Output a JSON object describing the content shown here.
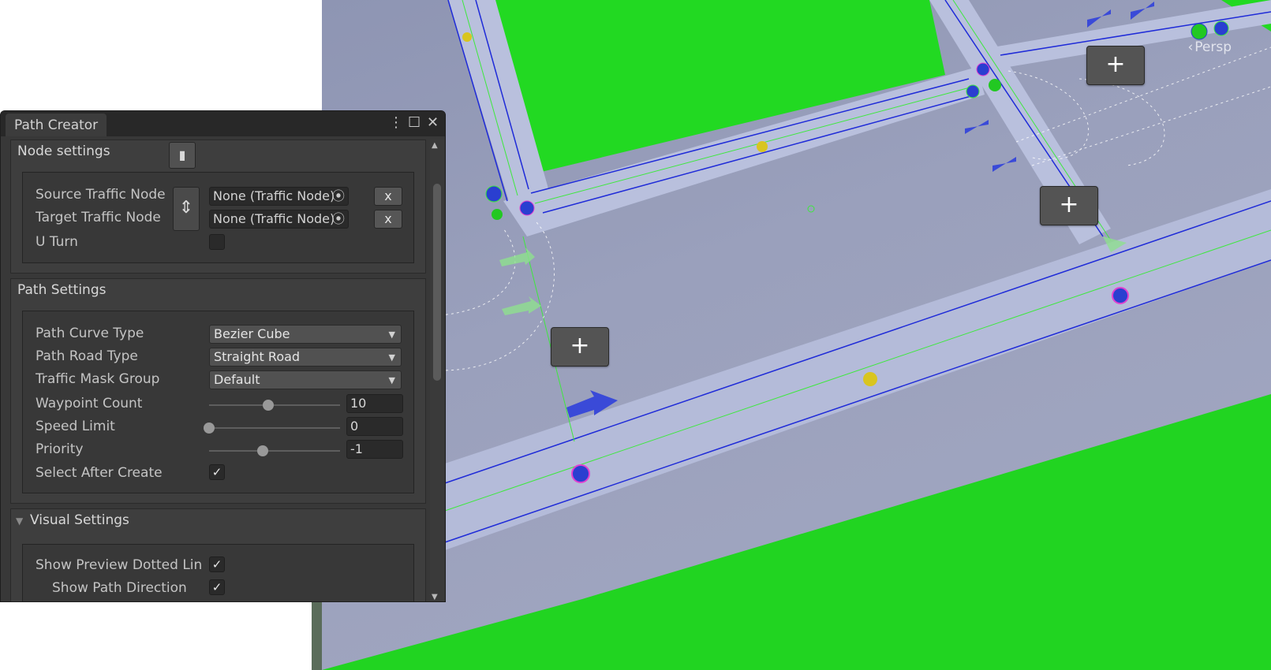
{
  "window": {
    "tab_title": "Path Creator",
    "menu_icon": "kebab-menu-icon",
    "maximize_icon": "maximize-icon",
    "close_icon": "close-icon"
  },
  "node_settings": {
    "title": "Node settings",
    "book_icon": "book-icon",
    "source_label": "Source Traffic Node",
    "source_value": "None (Traffic Node)",
    "target_label": "Target Traffic Node",
    "target_value": "None (Traffic Node)",
    "clear_label": "x",
    "swap_icon": "swap-vertical-icon",
    "uturn_label": "U Turn",
    "uturn_checked": false
  },
  "path_settings": {
    "title": "Path Settings",
    "curve_type_label": "Path Curve Type",
    "curve_type_value": "Bezier Cube",
    "road_type_label": "Path Road Type",
    "road_type_value": "Straight Road",
    "mask_group_label": "Traffic Mask Group",
    "mask_group_value": "Default",
    "waypoint_label": "Waypoint Count",
    "waypoint_value": "10",
    "waypoint_slider_fraction": 0.45,
    "speed_label": "Speed Limit",
    "speed_value": "0",
    "speed_slider_fraction": 0.0,
    "priority_label": "Priority",
    "priority_value": "-1",
    "priority_slider_fraction": 0.41,
    "select_after_label": "Select After Create",
    "select_after_checked": true
  },
  "visual_settings": {
    "title": "Visual Settings",
    "show_preview_label": "Show Preview Dotted Lin",
    "show_preview_checked": true,
    "show_direction_label": "Show Path Direction",
    "show_direction_checked": true
  },
  "scene": {
    "persp_label": "Persp",
    "add_button_label": "+",
    "colors": {
      "grass": "#22d922",
      "road": "#a4aac6",
      "sidewalk": "#b8bfdc",
      "lane_blue": "#1f2bd8",
      "lane_green": "#3ee83e",
      "waypoint_yellow": "#d9c51f",
      "node_pink": "#e040d0"
    }
  },
  "check_glyph": "✓"
}
